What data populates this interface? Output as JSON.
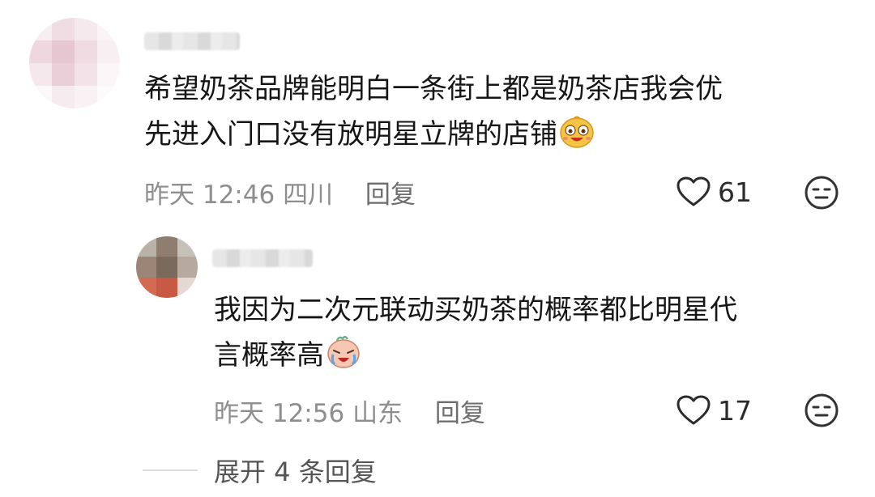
{
  "comments": [
    {
      "text_lines": [
        "希望奶茶品牌能明白一条街上都是奶茶店我会优",
        "先进入门口没有放明星立牌的店铺"
      ],
      "emoji": "laughing-face-emoji",
      "time": "昨天 12:46",
      "location": "四川",
      "reply_label": "回复",
      "like_count": "61",
      "avatar_colors": [
        "#f7eef1",
        "#f0dde3",
        "#f6e9ed",
        "#fbf4f6",
        "#eed7de",
        "#e6c7d1",
        "#f0dbe2",
        "#f8eff2",
        "#f5e8ec",
        "#e9cfd8",
        "#f3e2e8",
        "#fbf6f7",
        "#fcf8f9",
        "#f6ebee",
        "#f9f1f4",
        "#fdfafb"
      ]
    },
    {
      "text_lines": [
        "我因为二次元联动买奶茶的概率都比明星代",
        "言概率高"
      ],
      "emoji": "crying-face-emoji",
      "time": "昨天 12:56",
      "location": "山东",
      "reply_label": "回复",
      "like_count": "17",
      "avatar_colors": [
        "#b9b2a6",
        "#8f7d70",
        "#c7c2b9",
        "#9a8576",
        "#7a6a5e",
        "#b7a99d",
        "#d46a52",
        "#c85a43",
        "#e4d9d2"
      ]
    }
  ],
  "expand": {
    "label": "展开 4 条回复"
  },
  "icons": {
    "like": "heart-outline-icon",
    "dislike": "expressionless-face-icon"
  },
  "colors": {
    "text": "#161616",
    "meta": "#8e8e8e",
    "icon": "#333333"
  }
}
